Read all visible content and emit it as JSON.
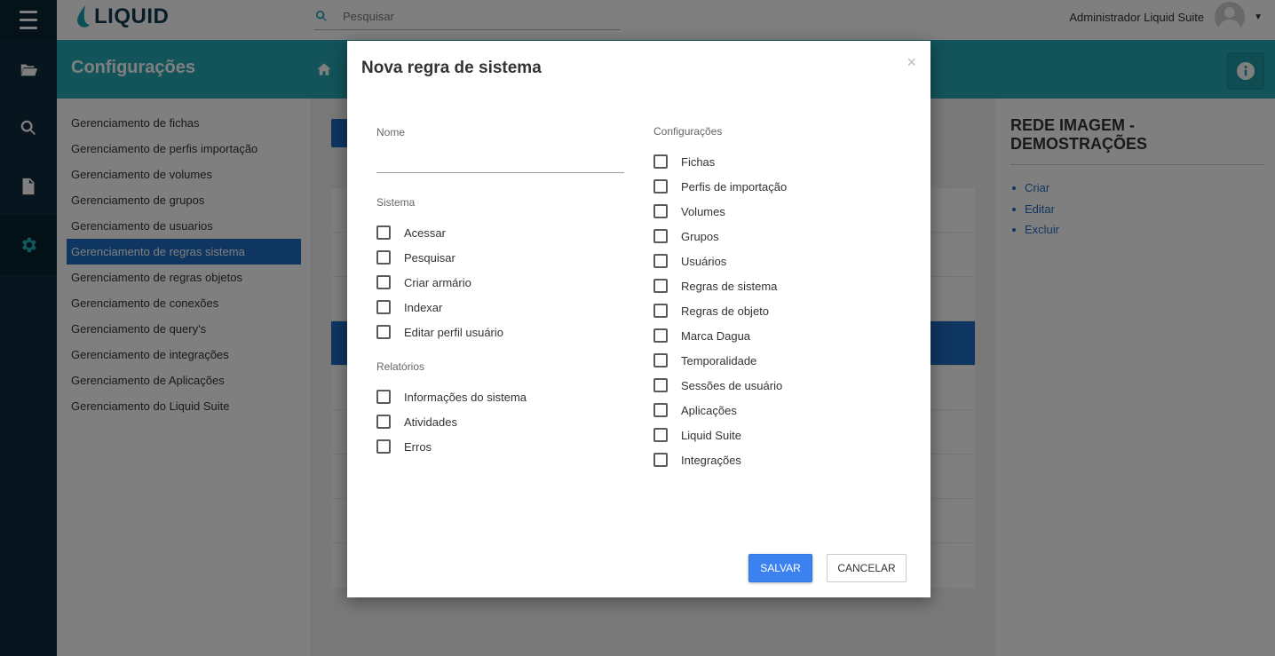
{
  "topbar": {
    "logo_text": "LIQUID",
    "search_placeholder": "Pesquisar",
    "user_name": "Administrador Liquid Suite"
  },
  "header": {
    "title": "Configurações"
  },
  "sidebar": {
    "items": [
      {
        "label": "Gerenciamento de fichas"
      },
      {
        "label": "Gerenciamento de perfis importação"
      },
      {
        "label": "Gerenciamento de volumes"
      },
      {
        "label": "Gerenciamento de grupos"
      },
      {
        "label": "Gerenciamento de usuarios"
      },
      {
        "label": "Gerenciamento de regras sistema",
        "active": true
      },
      {
        "label": "Gerenciamento de regras objetos"
      },
      {
        "label": "Gerenciamento de conexões"
      },
      {
        "label": "Gerenciamento de query's"
      },
      {
        "label": "Gerenciamento de integrações"
      },
      {
        "label": "Gerenciamento de Aplicações"
      },
      {
        "label": "Gerenciamento do Liquid Suite"
      }
    ]
  },
  "right_panel": {
    "title": "REDE IMAGEM - DEMOSTRAÇÕES",
    "links": [
      "Criar",
      "Editar",
      "Excluir"
    ]
  },
  "modal": {
    "title": "Nova regra de sistema",
    "close_symbol": "×",
    "name_label": "Nome",
    "name_value": "",
    "sistema_label": "Sistema",
    "sistema_items": [
      "Acessar",
      "Pesquisar",
      "Criar armário",
      "Indexar",
      "Editar perfil usuário"
    ],
    "relatorios_label": "Relatórios",
    "relatorios_items": [
      "Informações do sistema",
      "Atividades",
      "Erros"
    ],
    "config_label": "Configurações",
    "config_items": [
      "Fichas",
      "Perfis de importação",
      "Volumes",
      "Grupos",
      "Usuários",
      "Regras de sistema",
      "Regras de objeto",
      "Marca Dagua",
      "Temporalidade",
      "Sessões de usuário",
      "Aplicações",
      "Liquid Suite",
      "Integrações"
    ],
    "save_label": "SALVAR",
    "cancel_label": "CANCELAR"
  },
  "colors": {
    "accent": "#24a8b4",
    "nav_dark": "#0e2d3d",
    "primary": "#1f6bc2",
    "save_button": "#3b82f0"
  }
}
